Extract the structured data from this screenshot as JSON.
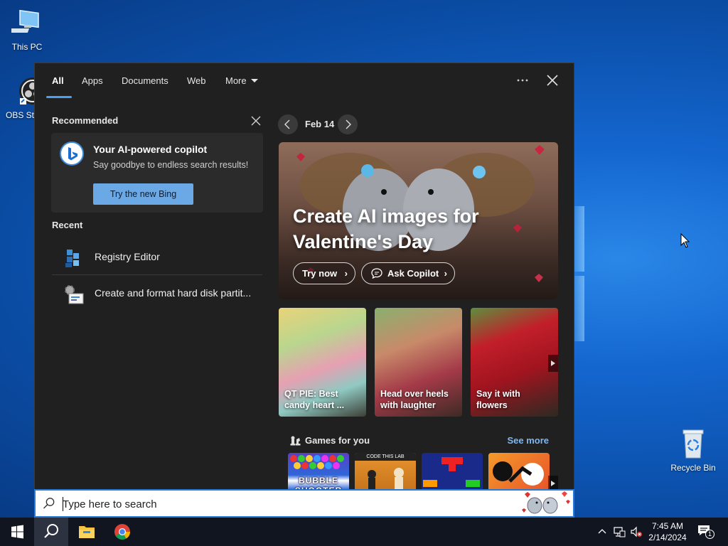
{
  "desktop": {
    "icons": [
      {
        "label": "This PC",
        "icon": "computer-icon"
      },
      {
        "label": "OBS Stu",
        "icon": "obs-icon"
      },
      {
        "label": "Recycle Bin",
        "icon": "recycle-bin-icon"
      }
    ]
  },
  "search": {
    "tabs": [
      {
        "label": "All",
        "active": true
      },
      {
        "label": "Apps"
      },
      {
        "label": "Documents"
      },
      {
        "label": "Web"
      },
      {
        "label": "More"
      }
    ],
    "more_icon": "ellipsis-icon",
    "close_icon": "close-icon",
    "recommended": {
      "title": "Recommended",
      "card_title": "Your AI-powered copilot",
      "card_subtitle": "Say goodbye to endless search results!",
      "button": "Try the new Bing"
    },
    "recent": {
      "title": "Recent",
      "items": [
        {
          "label": "Registry Editor",
          "icon": "registry-editor-icon"
        },
        {
          "label": "Create and format hard disk partit...",
          "icon": "disk-management-icon"
        }
      ]
    },
    "highlights": {
      "date": "Feb 14",
      "hero_title": "Create AI images for Valentine's Day",
      "try_now": "Try now",
      "ask_copilot": "Ask Copilot",
      "tiles": [
        {
          "caption": "QT PIE: Best candy heart ..."
        },
        {
          "caption": "Head over heels with laughter"
        },
        {
          "caption": "Say it with flowers"
        }
      ],
      "games_title": "Games for you",
      "see_more": "See more",
      "games": [
        {
          "label": "BUBBLE SHOOTER"
        },
        {
          "label": "CODE THIS LAB"
        },
        {
          "label": "blocks"
        },
        {
          "label": "stickman"
        }
      ]
    },
    "box": {
      "placeholder": "Type here to search"
    }
  },
  "taskbar": {
    "time": "7:45 AM",
    "date": "2/14/2024",
    "notification_count": "1"
  },
  "colors": {
    "accent": "#4aa0f0",
    "panel": "#202020",
    "taskbar": "#101520"
  }
}
